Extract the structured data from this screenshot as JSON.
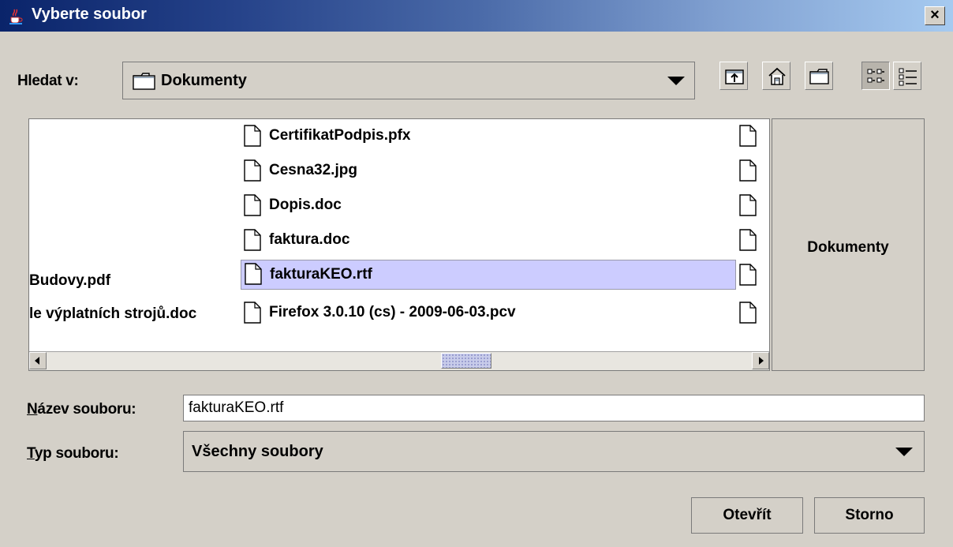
{
  "window": {
    "title": "Vyberte soubor",
    "close_glyph": "×",
    "app_icon": "java-cup-icon"
  },
  "look_in": {
    "label": "Hledat v:",
    "value": "Dokumenty"
  },
  "toolbar": [
    {
      "icon": "up-one-level-icon"
    },
    {
      "icon": "home-icon"
    },
    {
      "icon": "new-folder-icon"
    },
    {
      "icon": "list-view-icon",
      "pressed": true
    },
    {
      "icon": "details-view-icon"
    }
  ],
  "file_list": {
    "left_column": [
      "Budovy.pdf",
      "le výplatních strojů.doc"
    ],
    "middle_column": [
      "CertifikatPodpis.pfx",
      "Cesna32.jpg",
      "Dopis.doc",
      "faktura.doc",
      "fakturaKEO.rtf",
      "Firefox 3.0.10 (cs) - 2009-06-03.pcv"
    ],
    "selected": "fakturaKEO.rtf"
  },
  "side_panel": {
    "label": "Dokumenty"
  },
  "filename": {
    "label_u": "N",
    "label_rest": "ázev souboru:",
    "value": "fakturaKEO.rtf"
  },
  "filetype": {
    "label_u": "T",
    "label_rest": "yp souboru:",
    "value": "Všechny soubory"
  },
  "buttons": {
    "open": "Otevřít",
    "cancel": "Storno"
  }
}
